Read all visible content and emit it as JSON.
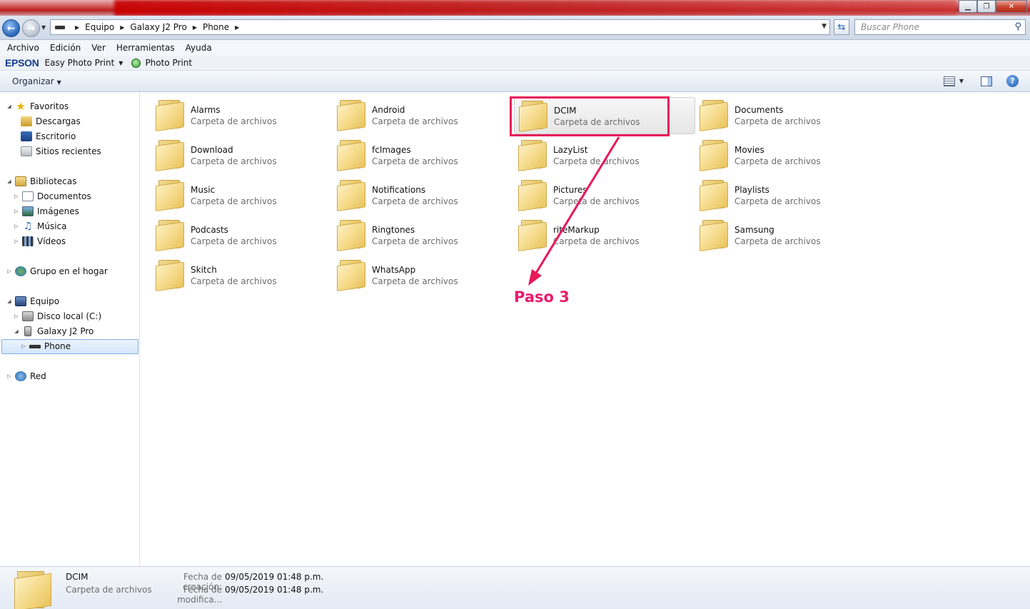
{
  "window": {
    "controls": {
      "minimize": "▁",
      "maximize": "❐",
      "close": "✕"
    }
  },
  "address": {
    "crumbs": [
      "Equipo",
      "Galaxy J2 Pro",
      "Phone"
    ],
    "search_placeholder": "Buscar Phone"
  },
  "menu": [
    "Archivo",
    "Edición",
    "Ver",
    "Herramientas",
    "Ayuda"
  ],
  "epson": {
    "logo": "EPSON",
    "easy_photo_print": "Easy Photo Print",
    "photo_print": "Photo Print"
  },
  "commandbar": {
    "organize": "Organizar"
  },
  "sidebar": {
    "favorites": {
      "label": "Favoritos",
      "items": [
        "Descargas",
        "Escritorio",
        "Sitios recientes"
      ]
    },
    "libraries": {
      "label": "Bibliotecas",
      "items": [
        "Documentos",
        "Imágenes",
        "Música",
        "Vídeos"
      ]
    },
    "homegroup": "Grupo en el hogar",
    "computer": {
      "label": "Equipo",
      "drive": "Disco local (C:)",
      "device": "Galaxy J2 Pro",
      "selected": "Phone"
    },
    "network": "Red"
  },
  "folders": [
    {
      "name": "Alarms",
      "type": "Carpeta de archivos"
    },
    {
      "name": "Android",
      "type": "Carpeta de archivos"
    },
    {
      "name": "DCIM",
      "type": "Carpeta de archivos"
    },
    {
      "name": "Documents",
      "type": "Carpeta de archivos"
    },
    {
      "name": "Download",
      "type": "Carpeta de archivos"
    },
    {
      "name": "fcImages",
      "type": "Carpeta de archivos"
    },
    {
      "name": "LazyList",
      "type": "Carpeta de archivos"
    },
    {
      "name": "Movies",
      "type": "Carpeta de archivos"
    },
    {
      "name": "Music",
      "type": "Carpeta de archivos"
    },
    {
      "name": "Notifications",
      "type": "Carpeta de archivos"
    },
    {
      "name": "Pictures",
      "type": "Carpeta de archivos"
    },
    {
      "name": "Playlists",
      "type": "Carpeta de archivos"
    },
    {
      "name": "Podcasts",
      "type": "Carpeta de archivos"
    },
    {
      "name": "Ringtones",
      "type": "Carpeta de archivos"
    },
    {
      "name": "riteMarkup",
      "type": "Carpeta de archivos"
    },
    {
      "name": "Samsung",
      "type": "Carpeta de archivos"
    },
    {
      "name": "Skitch",
      "type": "Carpeta de archivos"
    },
    {
      "name": "WhatsApp",
      "type": "Carpeta de archivos"
    }
  ],
  "annotation": {
    "label": "Paso 3",
    "color": "#e8185a"
  },
  "details": {
    "name": "DCIM",
    "type": "Carpeta de archivos",
    "created_label": "Fecha de creación:",
    "created_value": "09/05/2019 01:48 p.m.",
    "modified_label": "Fecha de modifica...",
    "modified_value": "09/05/2019 01:48 p.m."
  }
}
